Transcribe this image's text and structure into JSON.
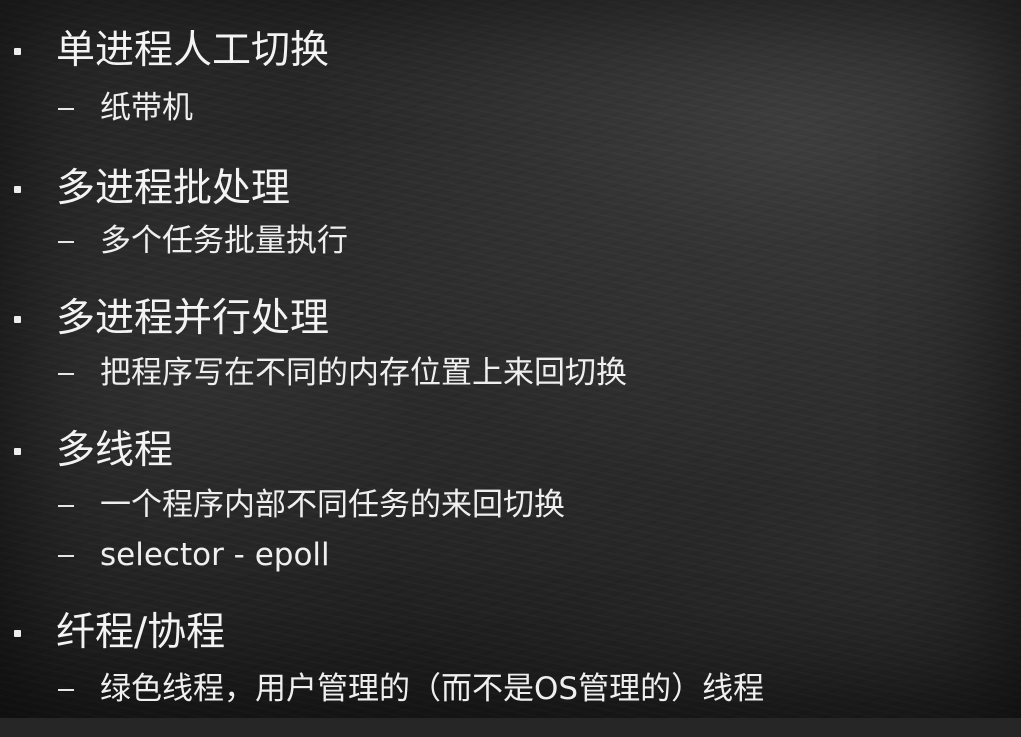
{
  "items": [
    {
      "title": "单进程人工切换",
      "subs": [
        "纸带机"
      ]
    },
    {
      "title": "多进程批处理",
      "subs": [
        "多个任务批量执行"
      ]
    },
    {
      "title": "多进程并行处理",
      "subs": [
        "把程序写在不同的内存位置上来回切换"
      ]
    },
    {
      "title": "多线程",
      "subs": [
        "一个程序内部不同任务的来回切换",
        "selector - epoll"
      ]
    },
    {
      "title": "纤程/协程",
      "subs": [
        "绿色线程，用户管理的（而不是OS管理的）线程"
      ]
    }
  ],
  "colors": {
    "background": "#262626",
    "text": "#f2f2f2"
  }
}
